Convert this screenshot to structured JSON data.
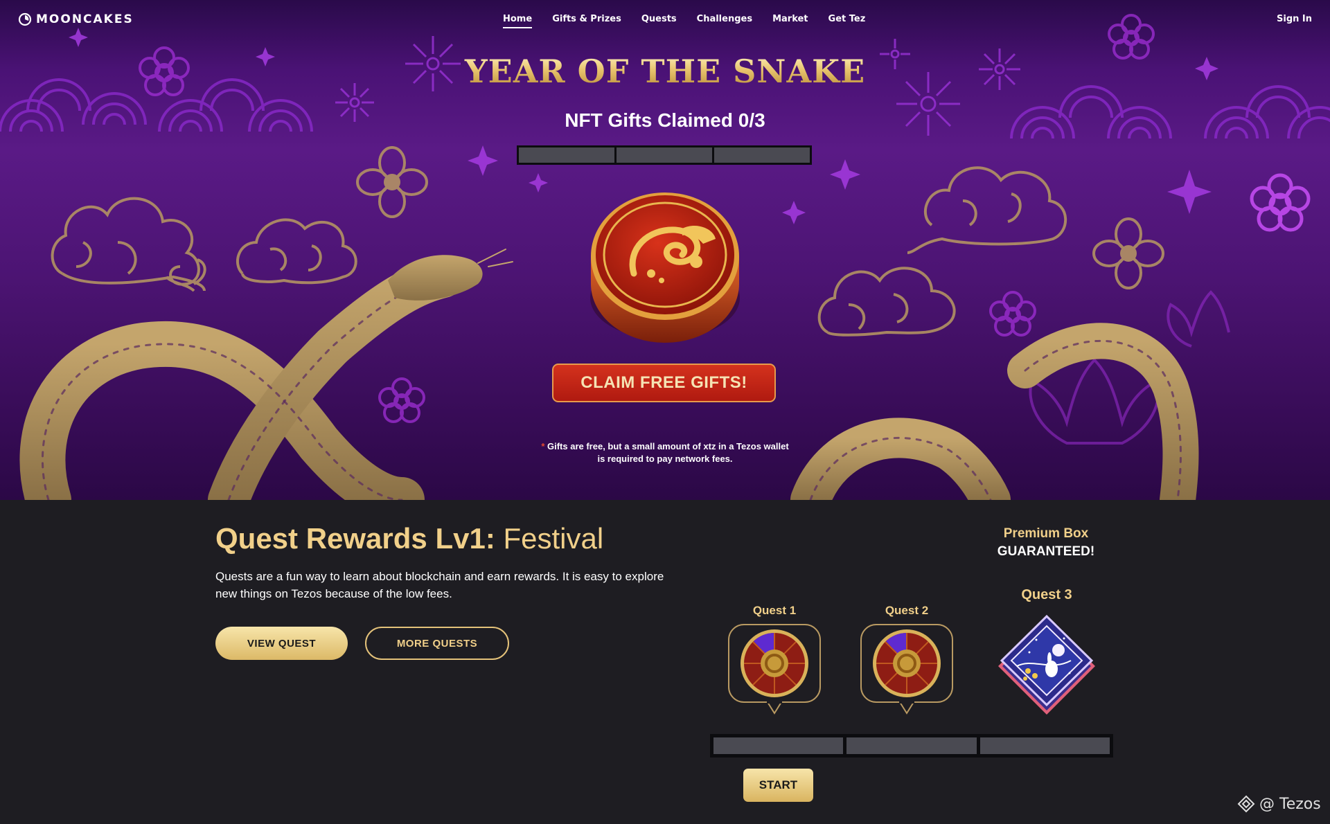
{
  "brand": {
    "name": "MOONCAKES"
  },
  "nav": {
    "links": [
      "Home",
      "Gifts & Prizes",
      "Quests",
      "Challenges",
      "Market",
      "Get Tez"
    ],
    "active": "Home",
    "sign_in": "Sign In"
  },
  "hero": {
    "title": "YEAR OF THE SNAKE",
    "claimed_text": "NFT Gifts Claimed 0/3",
    "claimed_progress": {
      "claimed": 0,
      "total": 3
    },
    "claim_button": "CLAIM FREE GIFTS!",
    "footnote_star": "*",
    "footnote_line1": "Gifts are free, but a small amount of xtz in a Tezos wallet",
    "footnote_line2": "is required to pay network fees."
  },
  "quests": {
    "title_bold": "Quest Rewards Lv1:",
    "title_light": "Festival",
    "description": "Quests are a fun way to learn about blockchain and earn rewards. It is easy to explore new things on Tezos because of the low fees.",
    "view_button": "VIEW QUEST",
    "more_button": "MORE QUESTS",
    "premium_line1": "Premium Box",
    "premium_line2": "GUARANTEED!",
    "items": [
      {
        "label": "Quest 1",
        "icon": "prize-wheel-icon"
      },
      {
        "label": "Quest 2",
        "icon": "prize-wheel-icon"
      },
      {
        "label": "Quest 3",
        "icon": "premium-box-icon"
      }
    ],
    "progress": {
      "completed": 0,
      "total": 3
    },
    "start_button": "START"
  },
  "watermark": {
    "text": "@ Tezos"
  },
  "colors": {
    "gold": "#f1d08a",
    "hero_purple": "#5a1a86",
    "claim_red": "#c0251a",
    "dark_bg": "#1e1d22",
    "progress_empty": "#4a4a52"
  }
}
